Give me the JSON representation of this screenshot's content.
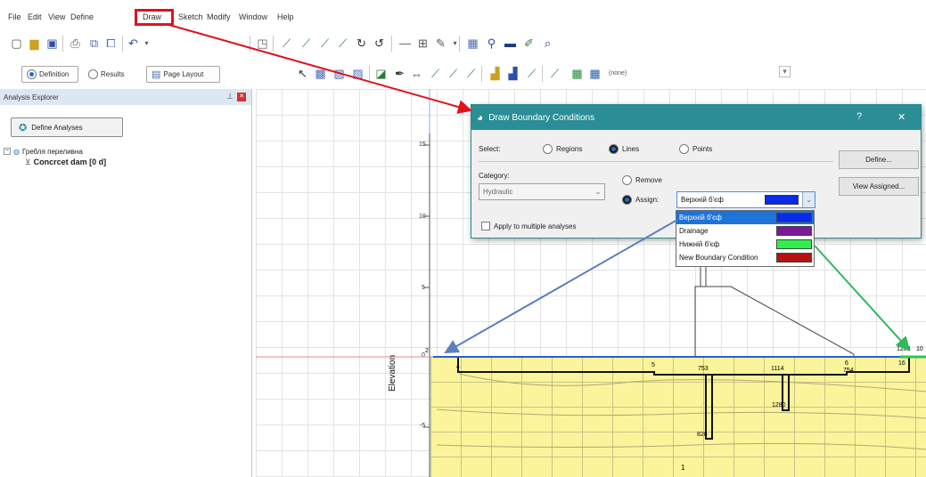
{
  "menu": {
    "file": "File",
    "edit": "Edit",
    "view": "View",
    "define": "Define",
    "draw": "Draw",
    "sketch": "Sketch",
    "modify": "Modify",
    "window": "Window",
    "help": "Help"
  },
  "modes": {
    "definition": "Definition",
    "results": "Results",
    "page_layout": "Page Layout",
    "property_selector": "(none)"
  },
  "explorer": {
    "title": "Analysis Explorer",
    "define_analyses": "Define Analyses",
    "tree_root": "Гребля переливна",
    "tree_child": "Concrcet dam [0 d]"
  },
  "canvas": {
    "axis_label": "Elevation",
    "ticks": [
      "15",
      "10",
      "5",
      "0",
      "-5"
    ],
    "node_labels": [
      "2",
      "4",
      "5",
      "753",
      "1114",
      "6",
      "754",
      "16",
      "1288",
      "10",
      "1280",
      "828",
      "1"
    ]
  },
  "dialog": {
    "title": "Draw Boundary Conditions",
    "help": "?",
    "close": "✕",
    "select_label": "Select:",
    "regions": "Regions",
    "lines": "Lines",
    "points": "Points",
    "category_label": "Category:",
    "category_value": "Hydraulic",
    "remove": "Remove",
    "assign": "Assign:",
    "assign_value": "Верхній б'єф",
    "apply_multiple": "Apply to multiple analyses",
    "define_button": "Define...",
    "view_assigned_button": "View Assigned...",
    "options": [
      {
        "label": "Верхній б'єф",
        "color": "#0a2be8",
        "selected": true
      },
      {
        "label": "Drainage",
        "color": "#7a1a96",
        "selected": false
      },
      {
        "label": "Нижній б'єф",
        "color": "#2df04a",
        "selected": false
      },
      {
        "label": "New Boundary Condition",
        "color": "#b41212",
        "selected": false
      }
    ]
  },
  "colors": {
    "accent_red": "#e0121b",
    "title_teal": "#2b8d96",
    "soil_yellow": "#fbf49b",
    "blue_arrow": "#5b7fc0",
    "green_arrow": "#2fb85a"
  }
}
